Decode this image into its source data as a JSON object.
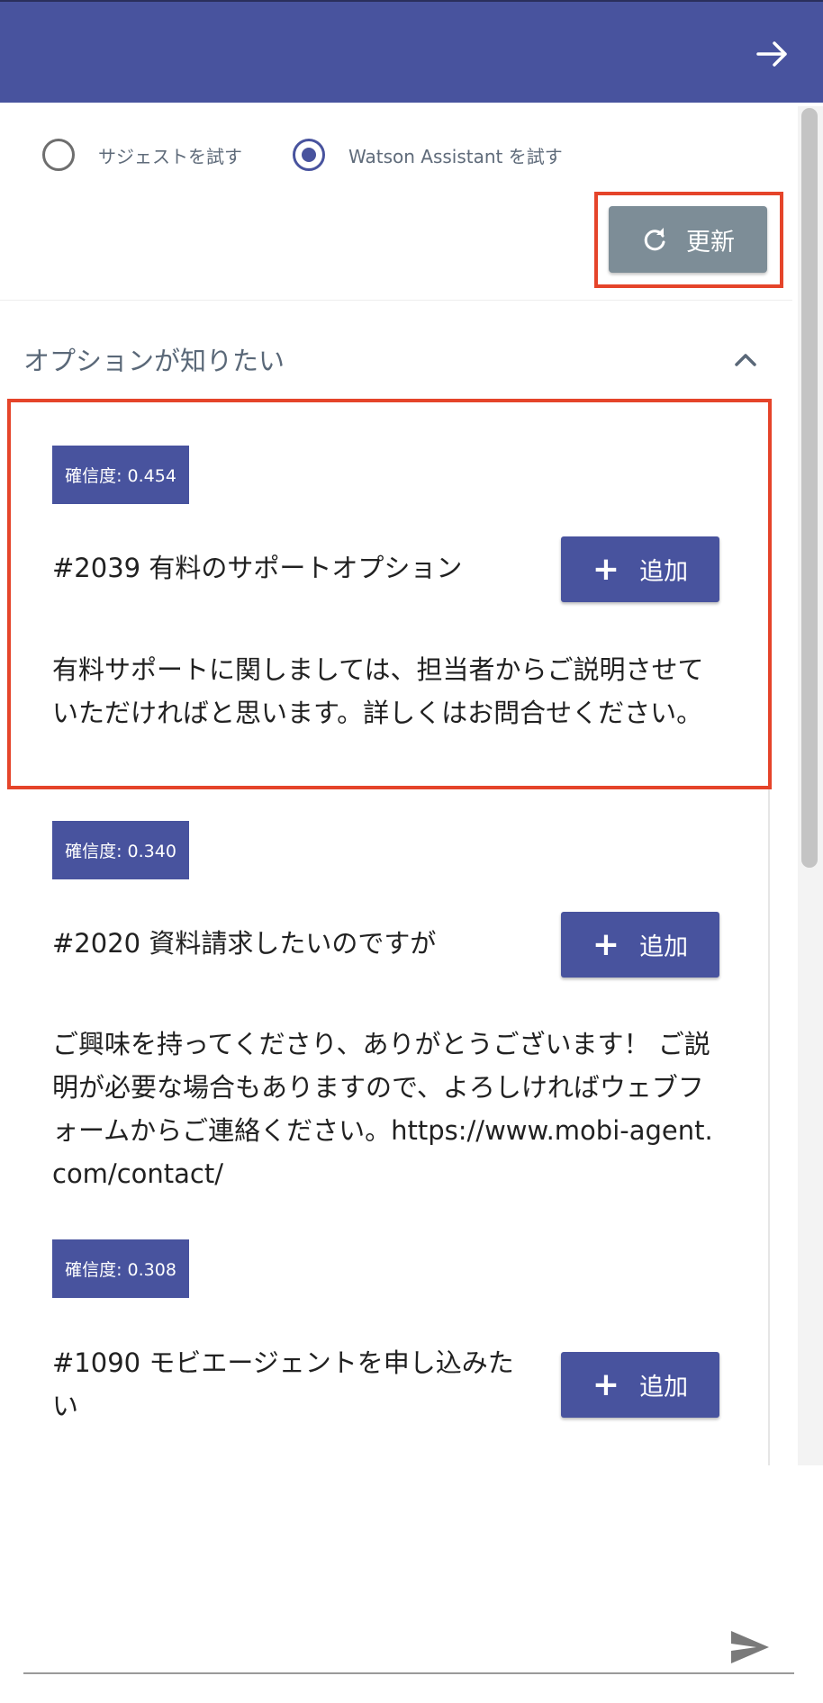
{
  "header": {
    "forward_icon": "arrow-right-icon",
    "background": "#48539e"
  },
  "mode": {
    "options": [
      {
        "label": "サジェストを試す",
        "selected": false
      },
      {
        "label": "Watson Assistant を試す",
        "selected": true
      }
    ]
  },
  "toolbar": {
    "refresh_label": "更新",
    "refresh_icon": "refresh-icon"
  },
  "section": {
    "title": "オプションが知りたい",
    "toggle_icon": "chevron-up-icon"
  },
  "results": [
    {
      "confidence": "確信度: 0.454",
      "title": "#2039 有料のサポートオプション",
      "add_label": "追加",
      "answer": "有料サポートに関しましては、担当者からご説明させていただければと思います。詳しくはお問合せください。"
    },
    {
      "confidence": "確信度: 0.340",
      "title": "#2020 資料請求したいのですが",
      "add_label": "追加",
      "answer": "ご興味を持ってくださり、ありがとうございます！ ご説明が必要な場合もありますので、よろしければウェブフォームからご連絡ください。https://www.mobi-agent.com/contact/"
    },
    {
      "confidence": "確信度: 0.308",
      "title": "#1090 モビエージェントを申し込みたい",
      "add_label": "追加",
      "answer": ""
    }
  ],
  "composer": {
    "placeholder": "",
    "send_icon": "send-icon"
  },
  "colors": {
    "accent": "#48539e",
    "highlight": "#e5442a",
    "refresh_button": "#7d8d97"
  }
}
